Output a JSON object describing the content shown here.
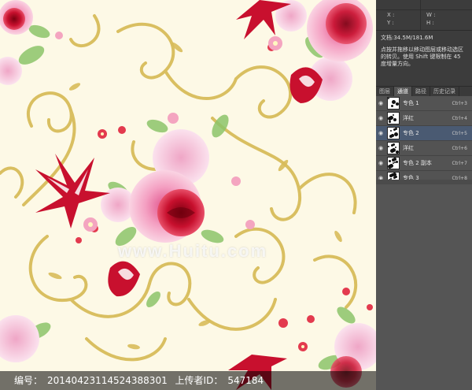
{
  "watermark": "www.Huitu.com",
  "caption": {
    "id_label": "编号：",
    "id_value": "20140423114524388301",
    "uploader_label": "上传者ID：",
    "uploader_value": "547184"
  },
  "info_panel": {
    "x_label": "X :",
    "y_label": "Y :",
    "w_label": "W :",
    "h_label": "H :",
    "doc_size": "文档:34.5M/181.6M",
    "hint": "点按并拖移以移动图层或移动选区的转贝。使用 Shift 键限制在 45 度增量方向。"
  },
  "panel_tabs": [
    "图层",
    "通道",
    "路径",
    "历史记录"
  ],
  "active_tab_index": 1,
  "channels": [
    {
      "name": "专色 1",
      "shortcut": "Ctrl+3",
      "visible": true,
      "selected": false
    },
    {
      "name": "洋红",
      "shortcut": "Ctrl+4",
      "visible": true,
      "selected": false
    },
    {
      "name": "专色 2",
      "shortcut": "Ctrl+5",
      "visible": true,
      "selected": true
    },
    {
      "name": "洋红",
      "shortcut": "Ctrl+6",
      "visible": true,
      "selected": false
    },
    {
      "name": "专色 2 副本",
      "shortcut": "Ctrl+7",
      "visible": true,
      "selected": false
    },
    {
      "name": "专色 3",
      "shortcut": "Ctrl+8",
      "visible": true,
      "selected": false
    }
  ],
  "colors": {
    "background": "#fdf9e6",
    "scroll_gold": "#d8bc5a",
    "rose_red": "#c8102e",
    "rose_pink": "#f4b6cf",
    "leaf_green": "#8cc46a"
  }
}
